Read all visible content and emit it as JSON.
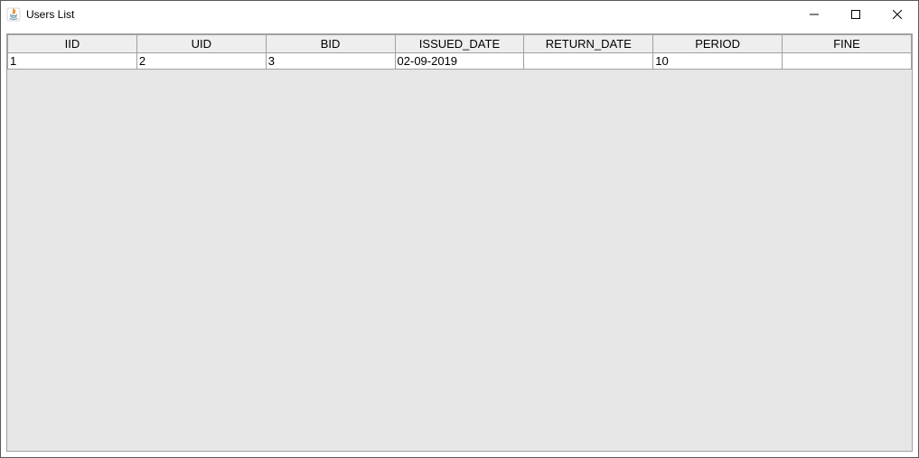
{
  "window": {
    "title": "Users List"
  },
  "table": {
    "columns": [
      "IID",
      "UID",
      "BID",
      "ISSUED_DATE",
      "RETURN_DATE",
      "PERIOD",
      "FINE"
    ],
    "rows": [
      {
        "iid": "1",
        "uid": "2",
        "bid": "3",
        "issued_date": "02-09-2019",
        "return_date": "",
        "period": "10",
        "fine": ""
      }
    ]
  }
}
